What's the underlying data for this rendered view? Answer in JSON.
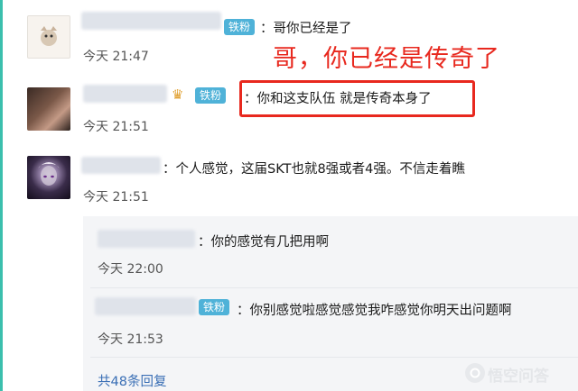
{
  "comments": [
    {
      "badge": "铁粉",
      "text": "：哥你已经是了",
      "time": "今天 21:47"
    },
    {
      "badge": "铁粉",
      "text": "：你和这支队伍 就是传奇本身了",
      "time": "今天 21:51"
    },
    {
      "text": "：个人感觉，这届SKT也就8强或者4强。不信走着瞧",
      "time": "今天 21:51"
    }
  ],
  "replies": [
    {
      "text": "：你的感觉有几把用啊",
      "time": "今天 22:00"
    },
    {
      "badge": "铁粉",
      "text": "：你别感觉啦感觉感觉我咋感觉你明天出问题啊",
      "time": "今天 21:53"
    }
  ],
  "more_replies": "共48条回复",
  "annotation": "哥，你已经是传奇了",
  "watermark": "悟空问答",
  "colors": {
    "badge": "#4fb2d8",
    "annotation": "#e8281e",
    "link": "#3a6fb5",
    "accent": "#3bbfad"
  }
}
